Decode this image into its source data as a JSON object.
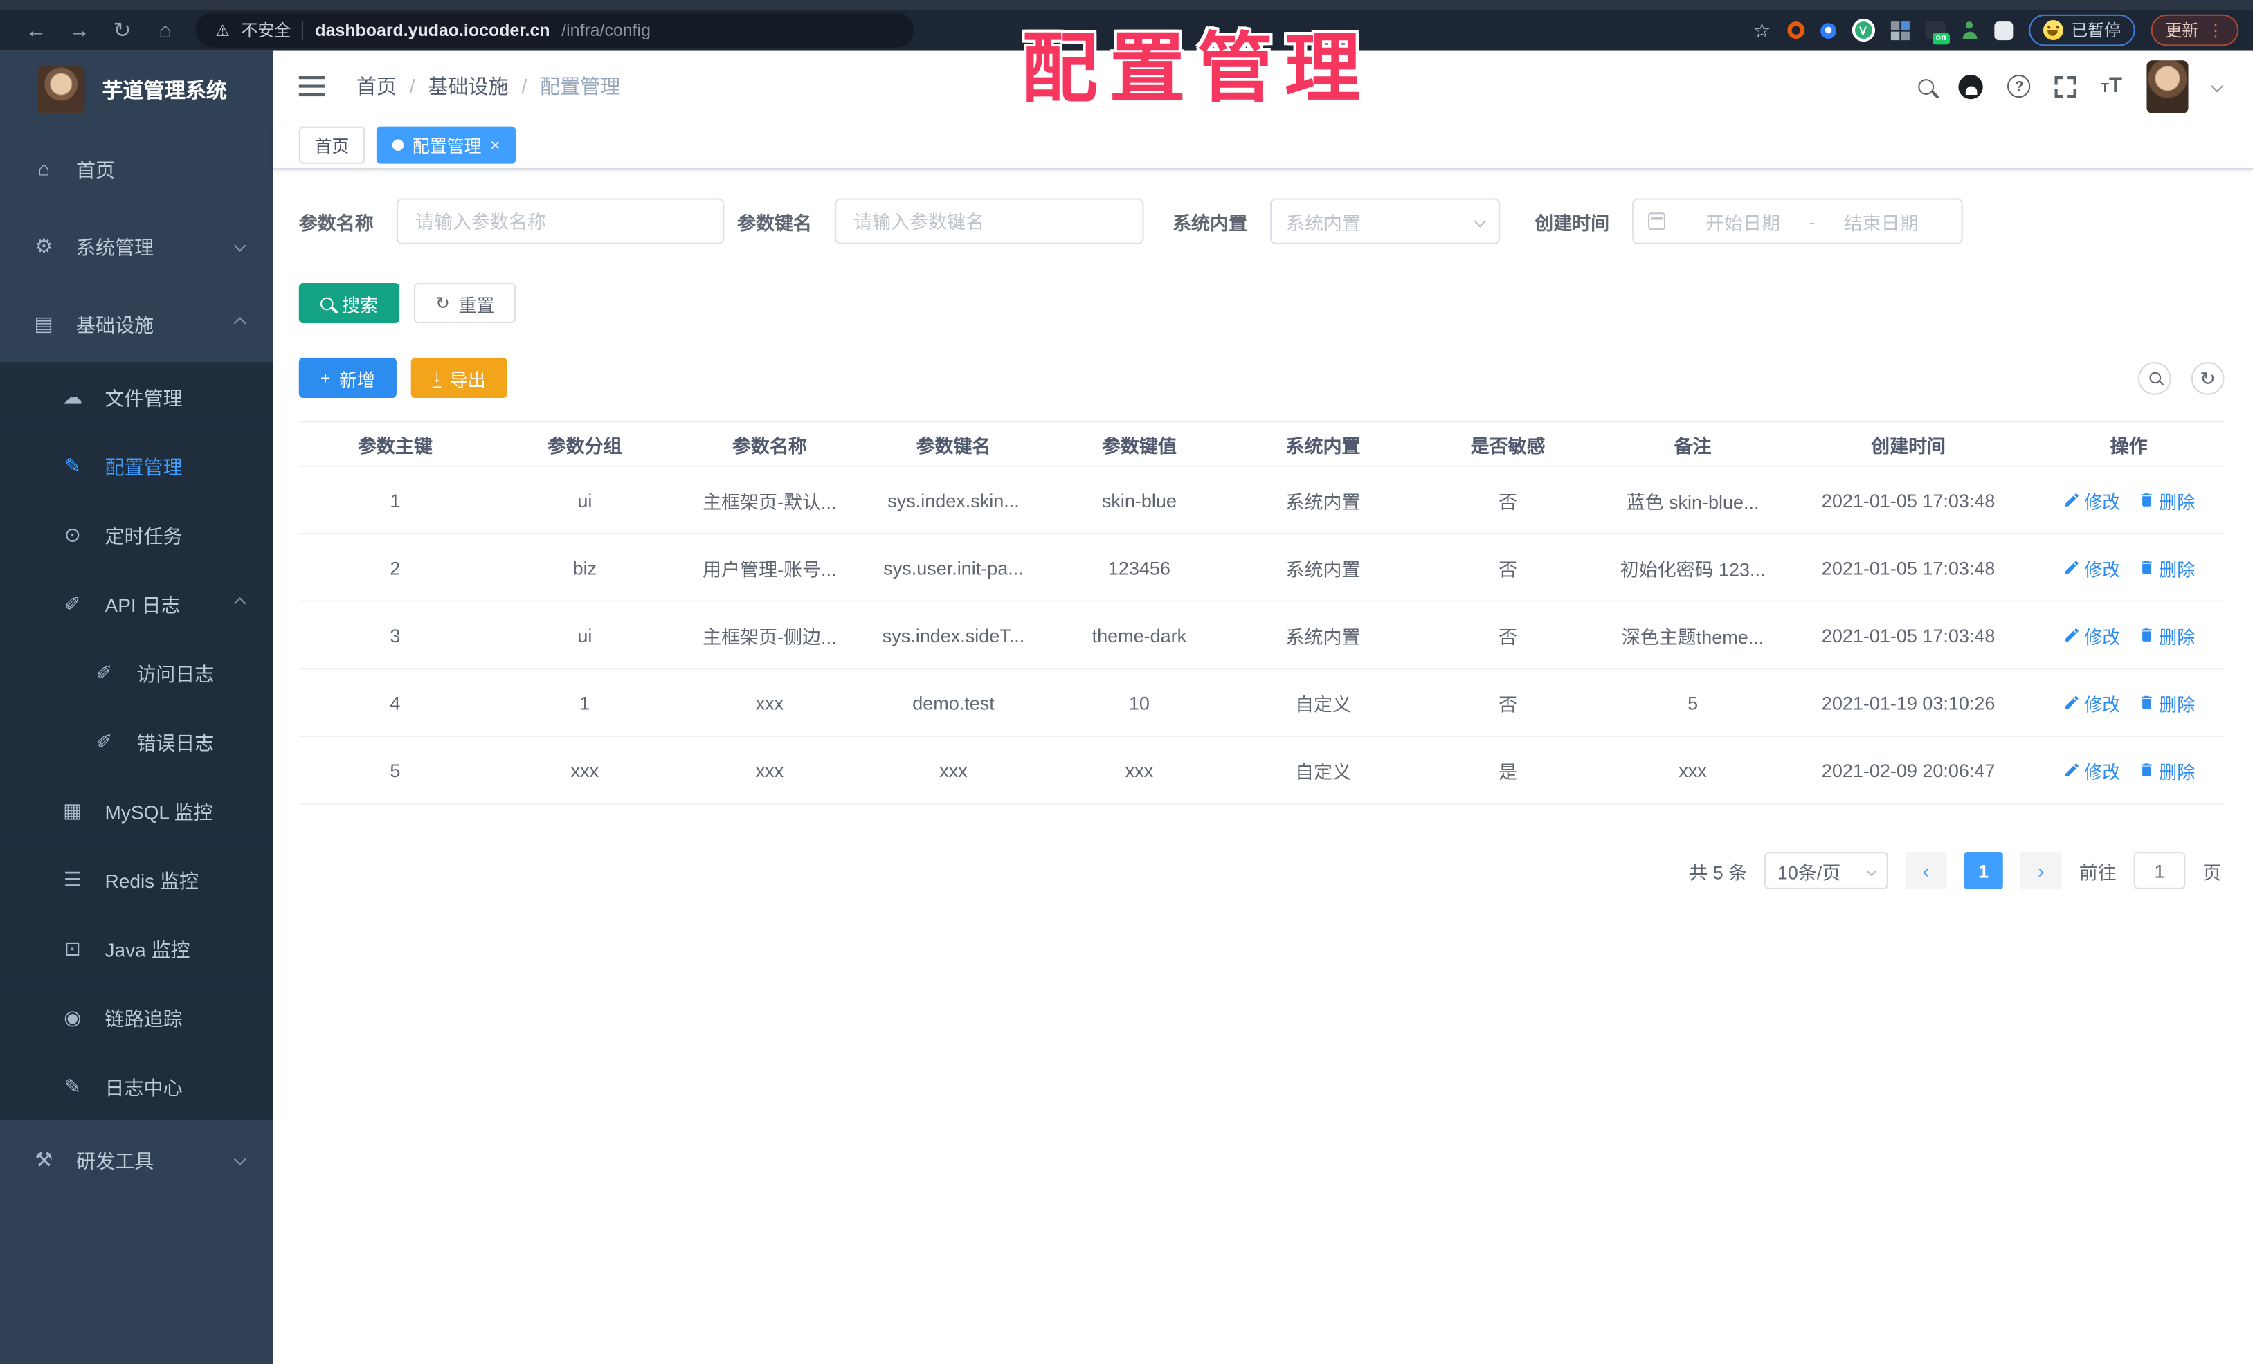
{
  "browser": {
    "security_label": "不安全",
    "url_host": "dashboard.yudao.iocoder.cn",
    "url_path": "/infra/config",
    "paused_label": "已暂停",
    "update_label": "更新",
    "ext_icons": [
      "bookmark-star",
      "orange-ring-extension",
      "blue-pin-extension",
      "vue-devtools-extension",
      "grid-extension",
      "screen-on-extension",
      "person-extension",
      "puzzle-extension"
    ]
  },
  "watermark": "配置管理",
  "sidebar": {
    "title": "芋道管理系统",
    "items": [
      {
        "id": "home",
        "label": "首页",
        "icon": "home-icon",
        "level": 0
      },
      {
        "id": "system",
        "label": "系统管理",
        "icon": "gear-icon",
        "level": 0,
        "arrow": "down"
      },
      {
        "id": "infra",
        "label": "基础设施",
        "icon": "monitor-icon",
        "level": 0,
        "arrow": "up"
      },
      {
        "id": "file",
        "label": "文件管理",
        "icon": "cloud-icon",
        "level": 1
      },
      {
        "id": "config",
        "label": "配置管理",
        "icon": "edit-icon",
        "level": 1,
        "active": true
      },
      {
        "id": "job",
        "label": "定时任务",
        "icon": "clock-icon",
        "level": 1
      },
      {
        "id": "api-log",
        "label": "API 日志",
        "icon": "log-icon",
        "level": 1,
        "arrow": "up"
      },
      {
        "id": "access-log",
        "label": "访问日志",
        "icon": "log-icon",
        "level": 2
      },
      {
        "id": "error-log",
        "label": "错误日志",
        "icon": "log-icon",
        "level": 2
      },
      {
        "id": "mysql",
        "label": "MySQL 监控",
        "icon": "chart-icon",
        "level": 1
      },
      {
        "id": "redis",
        "label": "Redis 监控",
        "icon": "stack-icon",
        "level": 1
      },
      {
        "id": "java",
        "label": "Java 监控",
        "icon": "screen-icon",
        "level": 1
      },
      {
        "id": "trace",
        "label": "链路追踪",
        "icon": "eye-icon",
        "level": 1
      },
      {
        "id": "log-center",
        "label": "日志中心",
        "icon": "edit-icon",
        "level": 1
      },
      {
        "id": "dev-tools",
        "label": "研发工具",
        "icon": "tool-icon",
        "level": 0,
        "arrow": "down"
      }
    ]
  },
  "header": {
    "breadcrumbs": [
      "首页",
      "基础设施",
      "配置管理"
    ]
  },
  "tabs": [
    {
      "label": "首页",
      "active": false
    },
    {
      "label": "配置管理",
      "active": true
    }
  ],
  "filters": {
    "name_label": "参数名称",
    "name_placeholder": "请输入参数名称",
    "key_label": "参数键名",
    "key_placeholder": "请输入参数键名",
    "type_label": "系统内置",
    "type_placeholder": "系统内置",
    "date_label": "创建时间",
    "date_start_placeholder": "开始日期",
    "date_separator": "-",
    "date_end_placeholder": "结束日期",
    "search_label": "搜索",
    "reset_label": "重置"
  },
  "toolbar": {
    "add_label": "新增",
    "export_label": "导出"
  },
  "table": {
    "columns": [
      "参数主键",
      "参数分组",
      "参数名称",
      "参数键名",
      "参数键值",
      "系统内置",
      "是否敏感",
      "备注",
      "创建时间",
      "操作"
    ],
    "rows": [
      [
        "1",
        "ui",
        "主框架页-默认...",
        "sys.index.skin...",
        "skin-blue",
        "系统内置",
        "否",
        "蓝色 skin-blue...",
        "2021-01-05 17:03:48"
      ],
      [
        "2",
        "biz",
        "用户管理-账号...",
        "sys.user.init-pa...",
        "123456",
        "系统内置",
        "否",
        "初始化密码 123...",
        "2021-01-05 17:03:48"
      ],
      [
        "3",
        "ui",
        "主框架页-侧边...",
        "sys.index.sideT...",
        "theme-dark",
        "系统内置",
        "否",
        "深色主题theme...",
        "2021-01-05 17:03:48"
      ],
      [
        "4",
        "1",
        "xxx",
        "demo.test",
        "10",
        "自定义",
        "否",
        "5",
        "2021-01-19 03:10:26"
      ],
      [
        "5",
        "xxx",
        "xxx",
        "xxx",
        "xxx",
        "自定义",
        "是",
        "xxx",
        "2021-02-09 20:06:47"
      ]
    ],
    "edit_label": "修改",
    "delete_label": "删除"
  },
  "pagination": {
    "total": "共 5 条",
    "page_size": "10条/页",
    "current_page": "1",
    "goto_label": "前往",
    "goto_value": "1",
    "page_unit": "页"
  },
  "colors": {
    "accent": "#409eff",
    "search_teal": "#14a385",
    "add_blue": "#2d8cf0",
    "export_amber": "#f2a41b",
    "link_blue": "#2d8cf0",
    "watermark_red": "#f5365f",
    "sidebar_bg": "#304156",
    "submenu_bg": "#1f2d3d"
  }
}
